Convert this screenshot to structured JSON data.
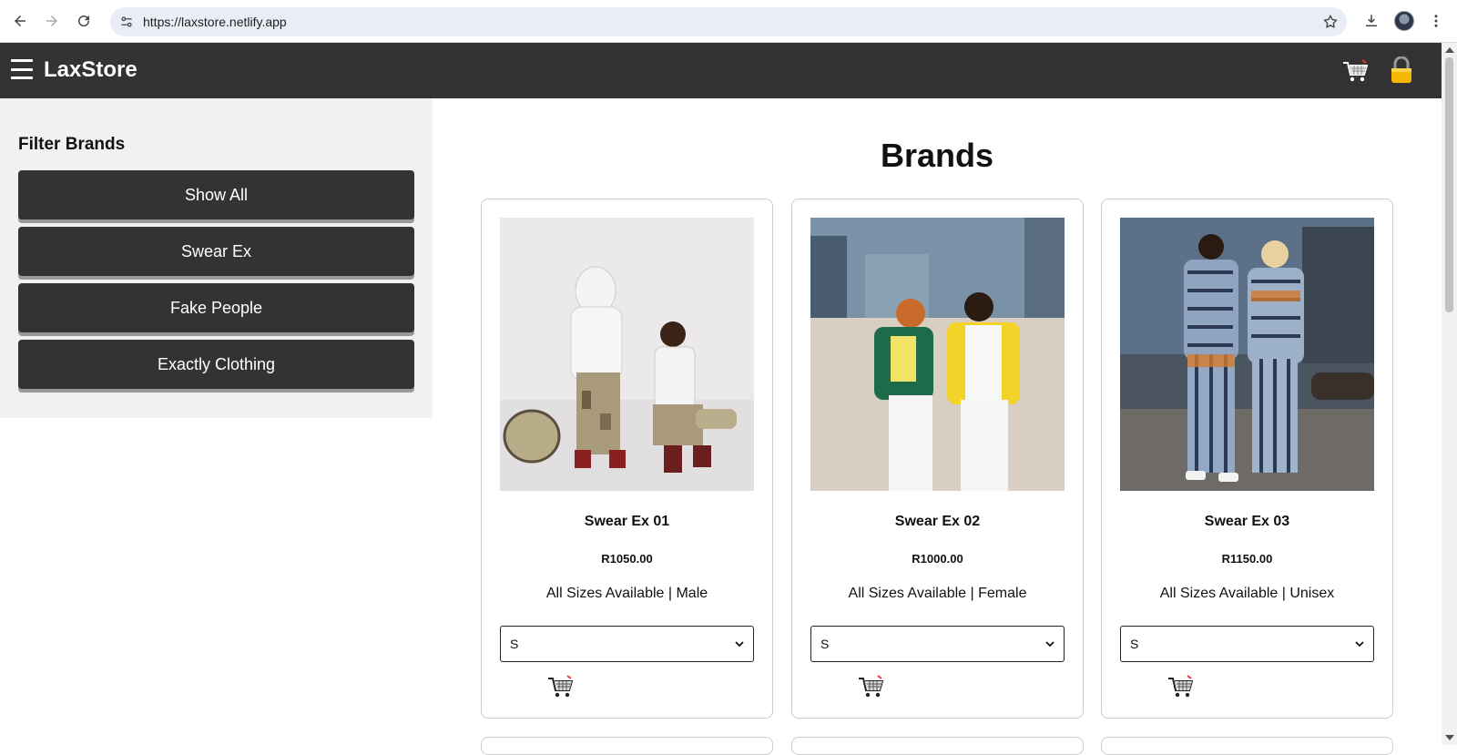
{
  "browser": {
    "url": "https://laxstore.netlify.app"
  },
  "header": {
    "logo": "LaxStore"
  },
  "sidebar": {
    "title": "Filter Brands",
    "filters": [
      {
        "label": "Show All"
      },
      {
        "label": "Swear Ex"
      },
      {
        "label": "Fake People"
      },
      {
        "label": "Exactly Clothing"
      }
    ]
  },
  "main": {
    "title": "Brands",
    "products": [
      {
        "name": "Swear Ex 01",
        "price": "R1050.00",
        "description": "All Sizes Available | Male",
        "size": "S"
      },
      {
        "name": "Swear Ex 02",
        "price": "R1000.00",
        "description": "All Sizes Available | Female",
        "size": "S"
      },
      {
        "name": "Swear Ex 03",
        "price": "R1150.00",
        "description": "All Sizes Available | Unisex",
        "size": "S"
      }
    ]
  },
  "colors": {
    "header_bg": "#333333",
    "sidebar_bg": "#f1f1f1",
    "lock_color": "#f5b800"
  },
  "icons": [
    "back-icon",
    "forward-icon",
    "reload-icon",
    "site-info-icon",
    "bookmark-star-icon",
    "download-icon",
    "profile-avatar-icon",
    "more-icon",
    "hamburger-icon",
    "cart-icon",
    "lock-icon"
  ]
}
